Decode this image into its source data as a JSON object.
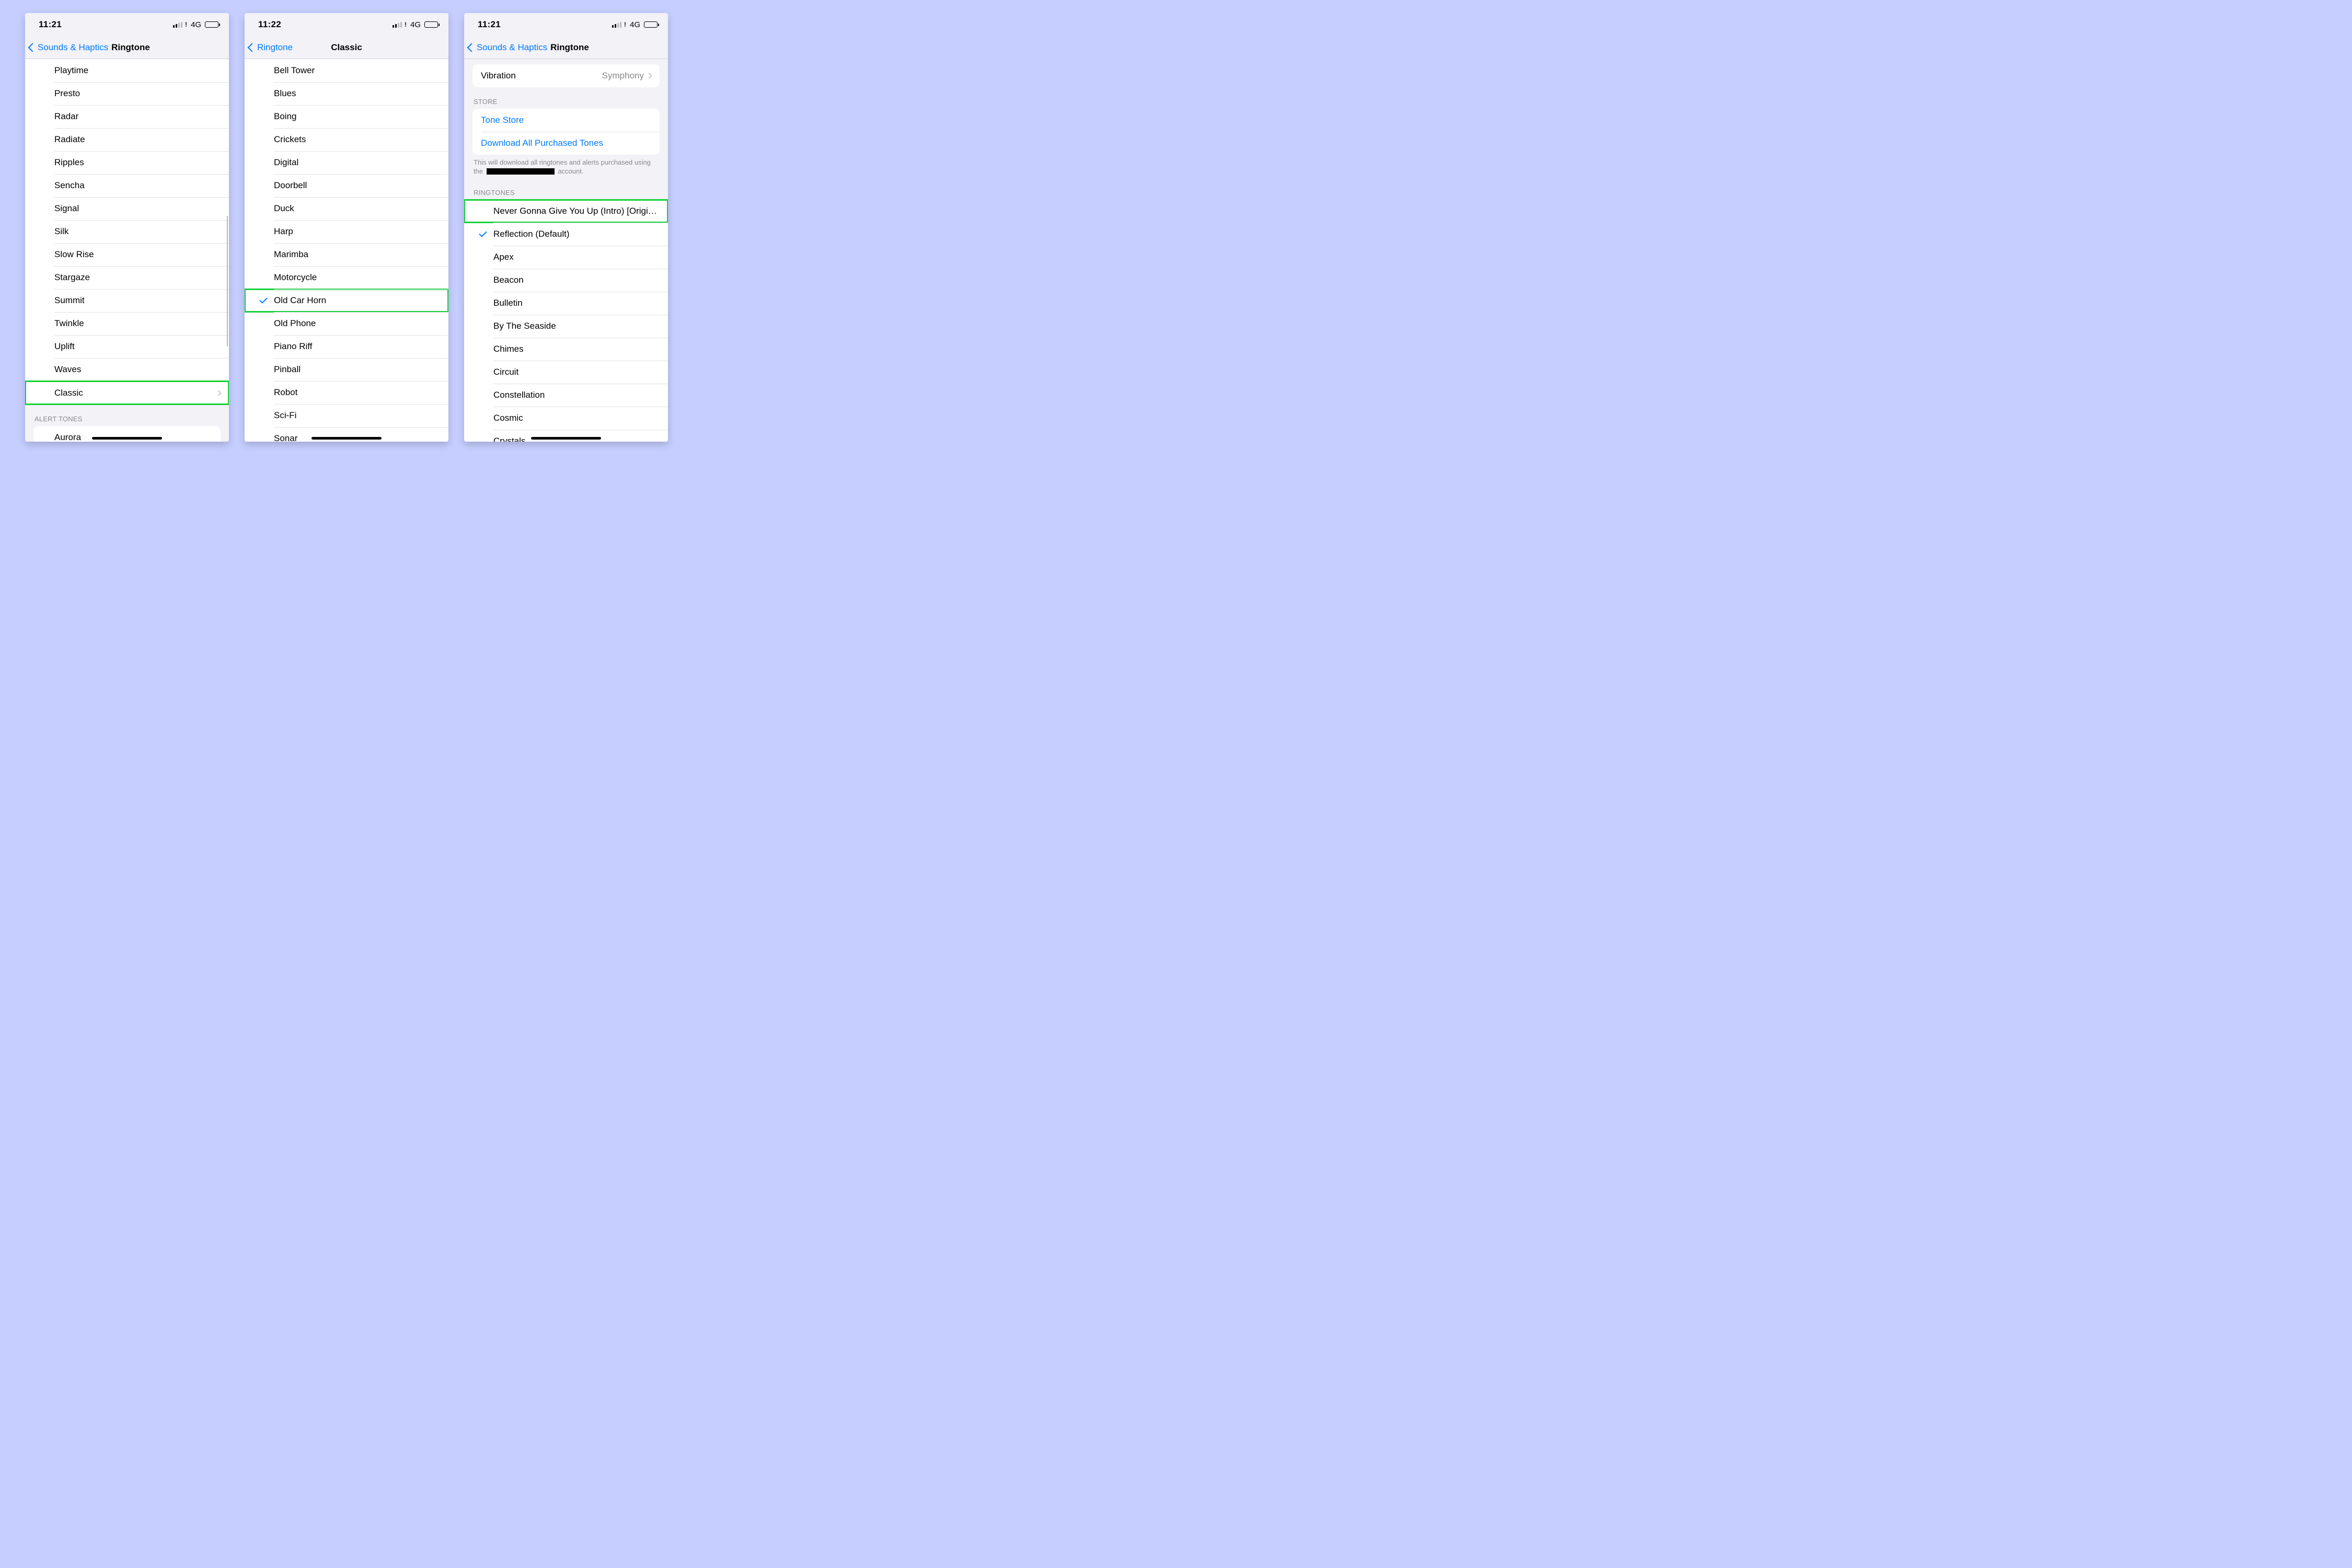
{
  "colors": {
    "blue": "#007aff",
    "bg": "#f2f2f7"
  },
  "statusTimes": {
    "p1": "11:21",
    "p2": "11:22",
    "p3": "11:21"
  },
  "network": "4G",
  "phone1": {
    "nav": {
      "back": "Sounds & Haptics",
      "title": "Ringtone"
    },
    "tones": [
      "Playtime",
      "Presto",
      "Radar",
      "Radiate",
      "Ripples",
      "Sencha",
      "Signal",
      "Silk",
      "Slow Rise",
      "Stargaze",
      "Summit",
      "Twinkle",
      "Uplift",
      "Waves"
    ],
    "classic": "Classic",
    "alertHeader": "ALERT TONES",
    "alertTones": [
      "Aurora"
    ]
  },
  "phone2": {
    "nav": {
      "back": "Ringtone",
      "title": "Classic"
    },
    "tones": [
      "Bell Tower",
      "Blues",
      "Boing",
      "Crickets",
      "Digital",
      "Doorbell",
      "Duck",
      "Harp",
      "Marimba",
      "Motorcycle",
      "Old Car Horn",
      "Old Phone",
      "Piano Riff",
      "Pinball",
      "Robot",
      "Sci-Fi",
      "Sonar"
    ],
    "selectedIndex": 10
  },
  "phone3": {
    "nav": {
      "back": "Sounds & Haptics",
      "title": "Ringtone"
    },
    "vibration": {
      "label": "Vibration",
      "value": "Symphony"
    },
    "storeHeader": "STORE",
    "storeLinks": [
      "Tone Store",
      "Download All Purchased Tones"
    ],
    "storeFoot1": "This will download all ringtones and alerts purchased using the",
    "storeFoot2": "account.",
    "ringtonesHeader": "RINGTONES",
    "custom": "Never Gonna Give You Up (Intro) [Origi…",
    "selected": "Reflection (Default)",
    "tones": [
      "Apex",
      "Beacon",
      "Bulletin",
      "By The Seaside",
      "Chimes",
      "Circuit",
      "Constellation",
      "Cosmic",
      "Crystals"
    ]
  }
}
